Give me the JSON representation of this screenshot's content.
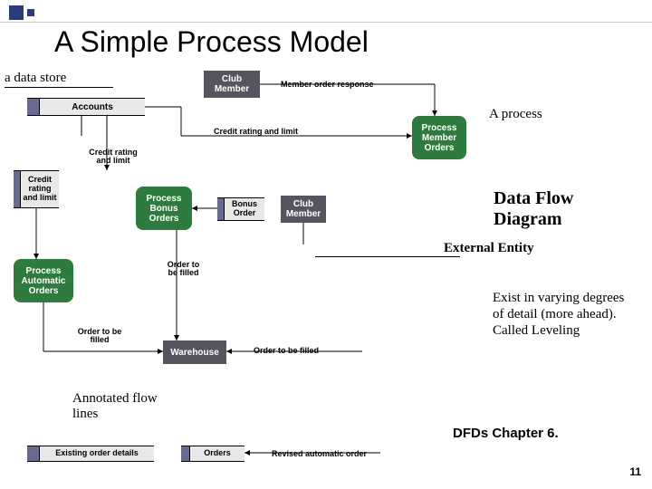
{
  "title": "A Simple Process Model",
  "labels": {
    "data_store": "a data store",
    "process": "A process",
    "dfd_l1": "Data Flow",
    "dfd_l2": "Diagram",
    "external_entity": "External Entity",
    "leveling": "Exist in varying degrees of detail (more ahead). Called Leveling",
    "annotated_flow_l1": "Annotated flow",
    "annotated_flow_l2": "lines",
    "dfds_chapter": "DFDs Chapter 6."
  },
  "page": "11",
  "nodes": {
    "accounts": "Accounts",
    "club_member_top": "Club Member",
    "process_member_orders": "Process Member Orders",
    "credit_rating_limit_ds": "Credit rating and limit",
    "process_bonus_orders": "Process Bonus Orders",
    "bonus_order_ds": "Bonus Order",
    "club_member_mid": "Club Member",
    "process_automatic_orders": "Process Automatic Orders",
    "warehouse": "Warehouse",
    "existing_order_details": "Existing order details",
    "orders_ds": "Orders"
  },
  "flows": {
    "member_order_response": "Member order response",
    "credit_rating_and_limit": "Credit rating and limit",
    "credit_rating_limit2": "Credit rating and limit",
    "order_to_be_filled_1": "Order to be filled",
    "order_to_be_filled_2": "Order to be filled",
    "order_to_be_filled_3": "Order to be filled",
    "revised_automatic_order": "Revised automatic order"
  }
}
